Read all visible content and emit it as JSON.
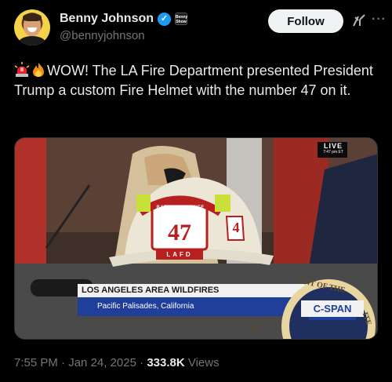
{
  "author": {
    "display_name": "Benny Johnson",
    "handle": "@bennyjohnson",
    "verified_icon": "verified-badge-icon",
    "affiliation_badge_text": "Benny Show"
  },
  "actions": {
    "follow_label": "Follow",
    "grok_icon": "grok-icon",
    "more_icon": "more-icon"
  },
  "tweet": {
    "emoji_1": "siren-emoji",
    "emoji_2": "fire-emoji",
    "text": "WOW! The LA Fire Department presented President Trump a custom Fire Helmet with the number 47 on it."
  },
  "media": {
    "live_label": "LIVE",
    "live_time": "7:47 pm ET",
    "helmet_top_text": "BATTALION CHIEF",
    "helmet_number": "47",
    "helmet_bottom_text": "LAFD",
    "helmet_side_number": "4",
    "chyron_title": "LOS ANGELES AREA WILDFIRES",
    "chyron_location": "Pacific Palisades, California",
    "network_logo": "C-SPAN",
    "seal_text_top": "ENT OF THE",
    "seal_text_left": "PR",
    "seal_text_right": "ITE"
  },
  "footer": {
    "time": "7:55 PM",
    "date": "Jan 24, 2025",
    "views_count": "333.8K",
    "views_label": "Views",
    "sep": "·"
  },
  "colors": {
    "background": "#000000",
    "text_primary": "#e7e9ea",
    "text_secondary": "#71767b",
    "verified": "#1d9bf0",
    "follow_bg": "#eff3f4"
  }
}
